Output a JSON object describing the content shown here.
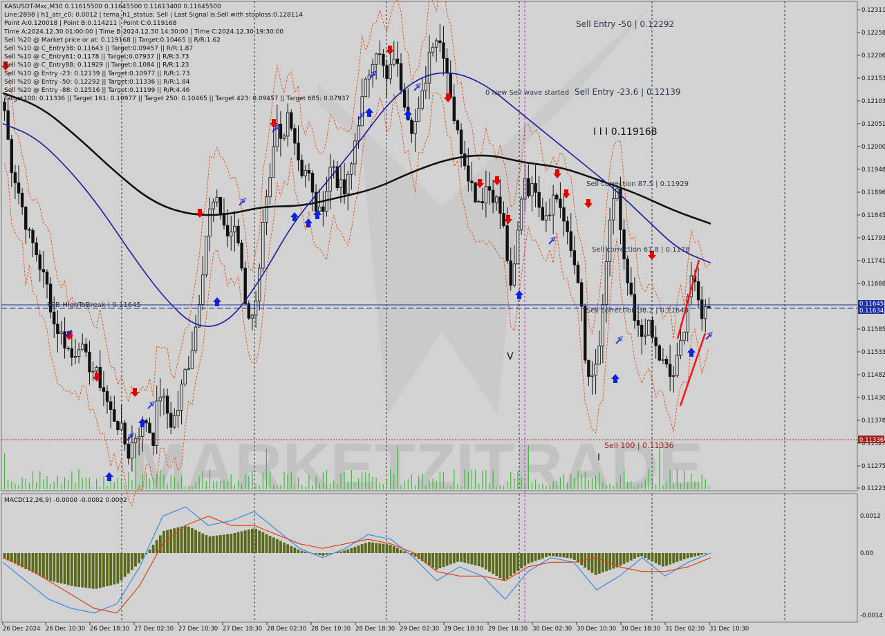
{
  "header": {
    "lines": [
      "KASUSDT-Mxc,M30  0.11615500 0.11645500 0.11613400 0.11645500",
      "Line:2898 | h1_atr_c0: 0.0012 | tema_h1_status: Sell | Last Signal is:Sell with stoploss:0.128114",
      "Point A:0.120018 | Point B:0.114211 | Point C:0.119168",
      "Time A:2024.12.30 01:00:00 | Time B:2024.12.30 14:30:00 | Time C:2024.12.30 19:30:00",
      "Sell %20 @ Market price or at: 0.119168 || Target:0.10465 || R/R:1.62",
      "Sell %10 @ C_Entry38: 0.11643 || Target:0.09457 || R/R:1.87",
      "Sell %10 @ C_Entry61: 0.1178 || Target:0.07937 || R/R:3.73",
      "Sell %10 @ C_Entry88: 0.11929 || Target:0.1084 || R/R:1.23",
      "Sell %10 @ Entry -23: 0.12139 || Target:0.10977 || R/R:1.73",
      "Sell %20 @ Entry -50: 0.12292 || Target:0.11336 || R/R:1.84",
      "Sell %20 @ Entry -88: 0.12516 || Target:0.11199 || R/R:4.46",
      "Target100: 0.11336 || Target 161: 0.10977 || Target 250: 0.10465 || Target 423: 0.09457 || Target 685: 0.07937"
    ]
  },
  "annotations": {
    "sell_entry_50": "Sell Entry -50 | 0.12292",
    "sell_entry_236": "Sell Entry -23.6 | 0.12139",
    "new_sell_wave": "0 New Sell wave started",
    "point_c": "I I I 0.119168",
    "sell_corr_875": "Sell correction 87.5 | 0.11929",
    "sell_corr_618": "Sell correction 61.8 | 0.1178",
    "sell_corr_382": "Sell correction 38.2 | 0.11643",
    "fsb": "FSB-HighToBreak | 0.11645",
    "sell_100": "Sell 100 | 0.11336",
    "wave_v": "V",
    "wave_i": "I"
  },
  "price_axis": {
    "labels": [
      "0.12311",
      "0.12258",
      "0.12206",
      "0.12153",
      "0.12103",
      "0.12051",
      "0.12000",
      "0.11948",
      "0.11896",
      "0.11845",
      "0.11793",
      "0.11741",
      "0.11688",
      "0.11585",
      "0.11533",
      "0.11482",
      "0.11430",
      "0.11378",
      "0.11327",
      "0.11275",
      "0.11223"
    ],
    "tag_current_1": "0.11645",
    "tag_current_2": "0.11634",
    "tag_target": "0.11336"
  },
  "macd": {
    "label": "MACD(12,26,9) -0.0000 -0.0002 0.0002",
    "axis_labels": [
      "0.0012",
      "0.00",
      "-0.0014"
    ]
  },
  "time_axis": {
    "labels": [
      "26 Dec 2024",
      "26 Dec 10:30",
      "26 Dec 18:30",
      "27 Dec 02:30",
      "27 Dec 10:30",
      "27 Dec 18:30",
      "28 Dec 02:30",
      "28 Dec 10:30",
      "28 Dec 18:30",
      "29 Dec 02:30",
      "29 Dec 10:30",
      "29 Dec 18:30",
      "30 Dec 02:30",
      "30 Dec 10:30",
      "30 Dec 18:30",
      "31 Dec 02:30",
      "31 Dec 10:30"
    ]
  },
  "watermark": "MARKETZITRADE",
  "colors": {
    "background": "#d2d2d2",
    "candle": "#111111",
    "ma_fast": "#1a1aa0",
    "ma_slow": "#111111",
    "envelope": "#e05010",
    "sell_arrow": "#e00000",
    "buy_arrow": "#1020e0",
    "volume": "#30c030",
    "macd_hist": "#5a6a1a",
    "macd_line": "#3a8ae0",
    "signal_line": "#e04010",
    "hline_blue": "#2030a0",
    "hline_red": "#a02020"
  },
  "chart_data": {
    "type": "candlestick",
    "symbol": "KASUSDT-Mxc",
    "timeframe": "M30",
    "ylim": [
      0.11223,
      0.12331
    ],
    "levels": [
      {
        "name": "Sell Entry -50",
        "value": 0.12292
      },
      {
        "name": "Sell Entry -23.6",
        "value": 0.12139
      },
      {
        "name": "Sell correction 87.5",
        "value": 0.11929
      },
      {
        "name": "Sell correction 61.8",
        "value": 0.1178
      },
      {
        "name": "Sell correction 38.2",
        "value": 0.11643
      },
      {
        "name": "FSB-HighToBreak",
        "value": 0.11645
      },
      {
        "name": "Sell 100",
        "value": 0.11336
      }
    ],
    "close_path": [
      0.1209,
      0.1197,
      0.1192,
      0.1186,
      0.118,
      0.1177,
      0.1172,
      0.1168,
      0.116,
      0.1158,
      0.1155,
      0.1152,
      0.1156,
      0.1152,
      0.115,
      0.1148,
      0.1145,
      0.114,
      0.1138,
      0.1135,
      0.113,
      0.1134,
      0.1136,
      0.1138,
      0.1133,
      0.1145,
      0.1141,
      0.1137,
      0.114,
      0.1148,
      0.1152,
      0.116,
      0.1172,
      0.1185,
      0.1188,
      0.1186,
      0.118,
      0.1182,
      0.1178,
      0.1165,
      0.116,
      0.117,
      0.1185,
      0.1192,
      0.1205,
      0.12,
      0.121,
      0.1202,
      0.1195,
      0.1196,
      0.1188,
      0.1185,
      0.119,
      0.1198,
      0.1192,
      0.119,
      0.1195,
      0.1205,
      0.1212,
      0.1218,
      0.1224,
      0.122,
      0.1215,
      0.1222,
      0.1216,
      0.121,
      0.1205,
      0.1208,
      0.1215,
      0.1225,
      0.1226,
      0.1223,
      0.1215,
      0.1205,
      0.12,
      0.1195,
      0.119,
      0.1188,
      0.1192,
      0.119,
      0.1187,
      0.118,
      0.1166,
      0.118,
      0.1195,
      0.119,
      0.1192,
      0.1185,
      0.1186,
      0.119,
      0.1187,
      0.118,
      0.1175,
      0.117,
      0.115,
      0.1146,
      0.1152,
      0.1165,
      0.1185,
      0.1192,
      0.1175,
      0.1168,
      0.116,
      0.1157,
      0.116,
      0.1156,
      0.1152,
      0.115,
      0.1147,
      0.1152,
      0.116,
      0.1172,
      0.1166,
      0.1162,
      0.1165
    ],
    "ma_fast_path": [
      0.1206,
      0.1203,
      0.1196,
      0.1187,
      0.1176,
      0.1166,
      0.1159,
      0.116,
      0.117,
      0.1183,
      0.1192,
      0.1201,
      0.1211,
      0.1217,
      0.1218,
      0.1215,
      0.1209,
      0.1203,
      0.1197,
      0.1191,
      0.1184,
      0.1177,
      0.1174
    ],
    "ma_slow_path": [
      0.1213,
      0.121,
      0.1203,
      0.1195,
      0.1188,
      0.1185,
      0.1185,
      0.1187,
      0.1187,
      0.1189,
      0.1191,
      0.1195,
      0.1198,
      0.1199,
      0.1197,
      0.1196,
      0.1193,
      0.119,
      0.1186,
      0.1183
    ],
    "macd_line_path": [
      -0.0002,
      -0.0006,
      -0.001,
      -0.0012,
      -0.0013,
      -0.0011,
      -0.0003,
      0.0008,
      0.001,
      0.0006,
      0.0007,
      0.0009,
      0.0005,
      0.0001,
      -0.0001,
      0.0001,
      0.0004,
      0.0003,
      -0.0001,
      -0.0006,
      -0.0003,
      -0.0005,
      -0.001,
      -0.0004,
      -0.0001,
      -0.0002,
      -0.0008,
      -0.0005,
      -0.0001,
      -0.0005,
      -0.0002,
      0.0
    ],
    "signal_line_path": [
      -0.0001,
      -0.0003,
      -0.0006,
      -0.0009,
      -0.0012,
      -0.0013,
      -0.0007,
      0.0002,
      0.0006,
      0.0008,
      0.0006,
      0.0006,
      0.0004,
      0.0002,
      0.0001,
      0.0002,
      0.0003,
      0.0002,
      0.0,
      -0.0004,
      -0.0005,
      -0.0005,
      -0.0006,
      -0.0003,
      -0.0002,
      -0.0002,
      -0.0001,
      -0.0003,
      -0.0004,
      -0.0004,
      -0.0003,
      -0.0001
    ]
  }
}
